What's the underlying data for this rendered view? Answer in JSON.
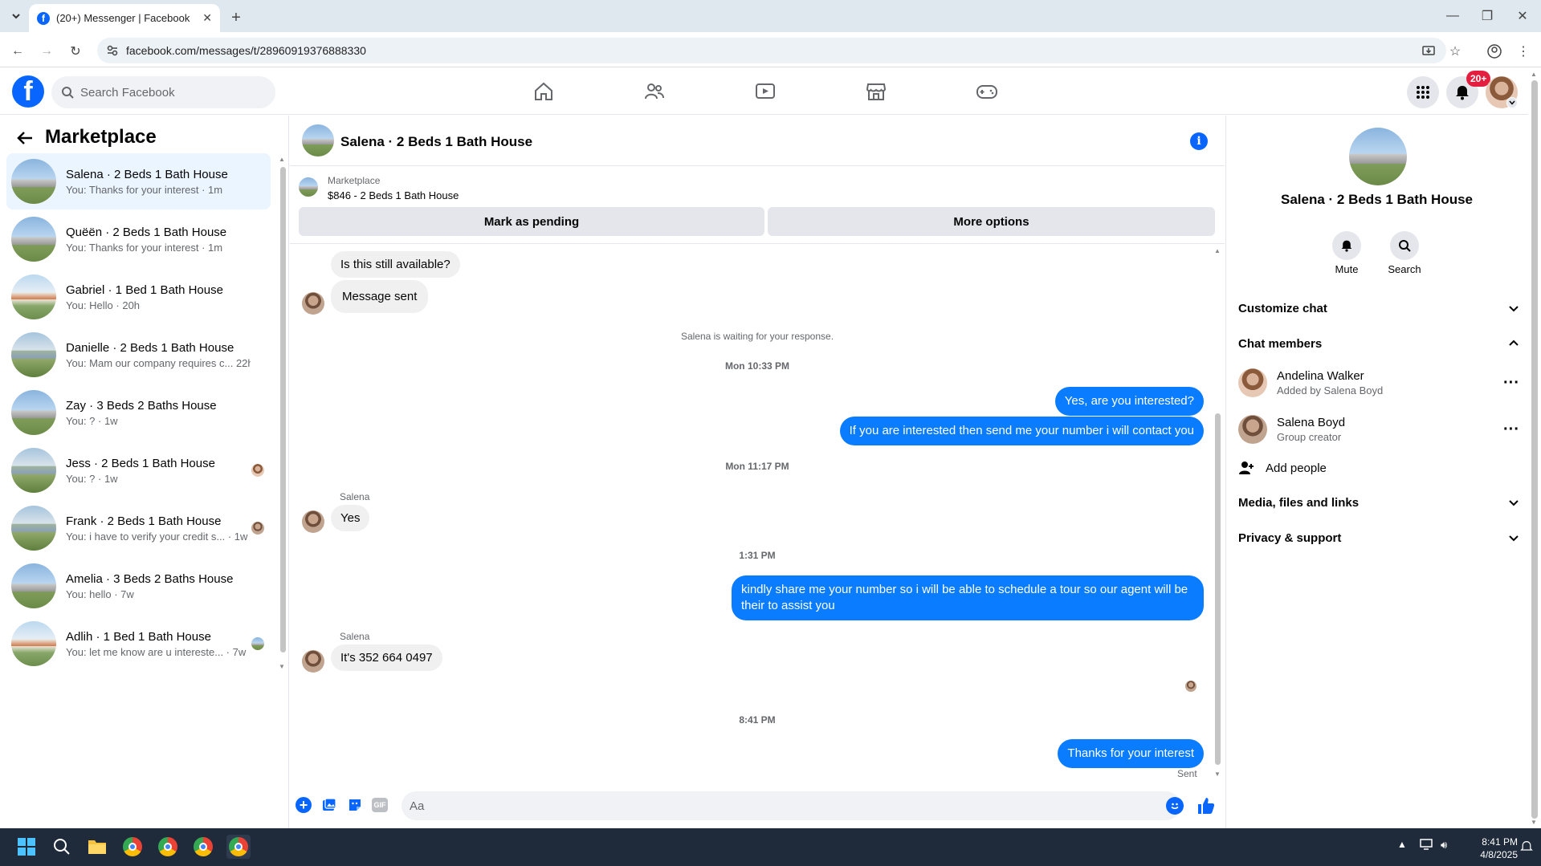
{
  "browser": {
    "tab_title": "(20+) Messenger | Facebook",
    "url": "facebook.com/messages/t/28960919376888330"
  },
  "fb": {
    "search_placeholder": "Search Facebook",
    "notification_badge": "20+"
  },
  "sidebar": {
    "title": "Marketplace",
    "conversations": [
      {
        "name": "Salena · 2 Beds 1 Bath House",
        "preview": "You: Thanks for your interest · 1m"
      },
      {
        "name": "Quëën · 2 Beds 1 Bath House",
        "preview": "You: Thanks for your interest · 1m"
      },
      {
        "name": "Gabriel · 1 Bed 1 Bath House",
        "preview": "You: Hello · 20h"
      },
      {
        "name": "Danielle · 2 Beds 1 Bath House",
        "preview": "You: Mam our company requires c...  22h"
      },
      {
        "name": "Zay · 3 Beds 2 Baths House",
        "preview": "You: ? · 1w"
      },
      {
        "name": "Jess · 2 Beds 1 Bath House",
        "preview": "You: ? · 1w"
      },
      {
        "name": "Frank · 2 Beds 1 Bath House",
        "preview": "You: i have to verify your credit s... · 1w"
      },
      {
        "name": "Amelia · 3 Beds 2 Baths House",
        "preview": "You: hello · 7w"
      },
      {
        "name": "Adlih · 1 Bed 1 Bath House",
        "preview": "You: let me know are u intereste... · 7w"
      }
    ]
  },
  "chat": {
    "title": "Salena · 2 Beds 1 Bath House",
    "listing_source": "Marketplace",
    "listing_desc": "$846 - 2 Beds 1 Bath House",
    "btn_pending": "Mark as pending",
    "btn_more": "More options",
    "messages": {
      "m1": "Is this still available?",
      "m2": "Message sent",
      "waiting": "Salena is waiting for your response.",
      "t1": "Mon 10:33 PM",
      "o1": "Yes, are you interested?",
      "o2": "If you are interested then send me your number i will contact you",
      "t2": "Mon 11:17 PM",
      "sender1": "Salena",
      "i3": "Yes",
      "t3": "1:31 PM",
      "o3": "kindly share me your number so i will be able to schedule a tour so our agent will be their to assist you",
      "sender2": "Salena",
      "i4": "It's 352 664 0497",
      "t4": "8:41 PM",
      "o4": "Thanks for your interest",
      "status": "Sent"
    },
    "input_placeholder": "Aa"
  },
  "rightpanel": {
    "title": "Salena · 2 Beds 1 Bath House",
    "mute": "Mute",
    "search": "Search",
    "customize": "Customize chat",
    "members_header": "Chat members",
    "members": [
      {
        "name": "Andelina Walker",
        "sub": "Added by Salena Boyd"
      },
      {
        "name": "Salena Boyd",
        "sub": "Group creator"
      }
    ],
    "add_people": "Add people",
    "media": "Media, files and links",
    "privacy": "Privacy & support"
  },
  "taskbar": {
    "time": "8:41 PM",
    "date": "4/8/2025"
  },
  "colors": {
    "brand": "#0866ff",
    "outgoing_bubble": "#0a7cff",
    "active_conv": "#ebf5ff",
    "badge": "#e41e3f"
  }
}
